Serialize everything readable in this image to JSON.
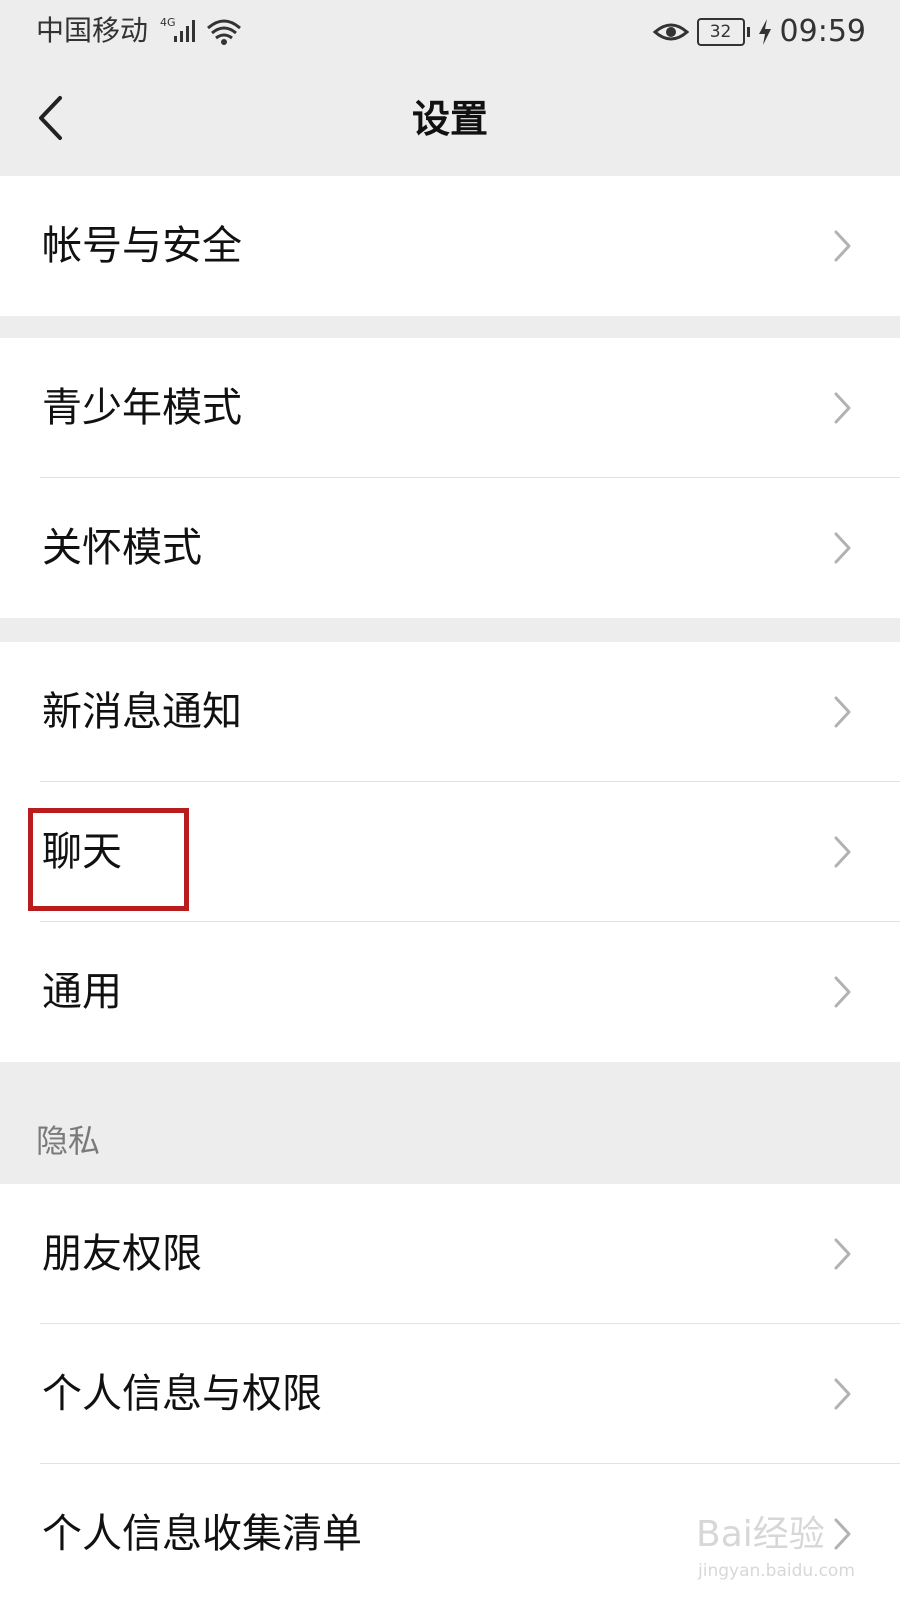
{
  "status_bar": {
    "carrier": "中国移动",
    "network": "4G",
    "battery": "32",
    "time": "09:59"
  },
  "nav": {
    "title": "设置"
  },
  "groups": [
    {
      "items": [
        {
          "label": "帐号与安全"
        }
      ]
    },
    {
      "items": [
        {
          "label": "青少年模式"
        },
        {
          "label": "关怀模式"
        }
      ]
    },
    {
      "items": [
        {
          "label": "新消息通知"
        },
        {
          "label": "聊天"
        },
        {
          "label": "通用"
        }
      ]
    }
  ],
  "privacy": {
    "section_title": "隐私",
    "items": [
      {
        "label": "朋友权限"
      },
      {
        "label": "个人信息与权限"
      },
      {
        "label": "个人信息收集清单"
      }
    ]
  },
  "colors": {
    "background": "#ededed",
    "card": "#ffffff",
    "text": "#111111",
    "section_text": "#7a7a7a",
    "highlight": "#b91c1c"
  },
  "icons": [
    "back-icon",
    "chevron-right-icon",
    "signal-icon",
    "wifi-icon",
    "eye-icon",
    "battery-icon",
    "charging-icon"
  ],
  "watermark": {
    "text": "Bai经验",
    "url": "jingyan.baidu.com"
  }
}
